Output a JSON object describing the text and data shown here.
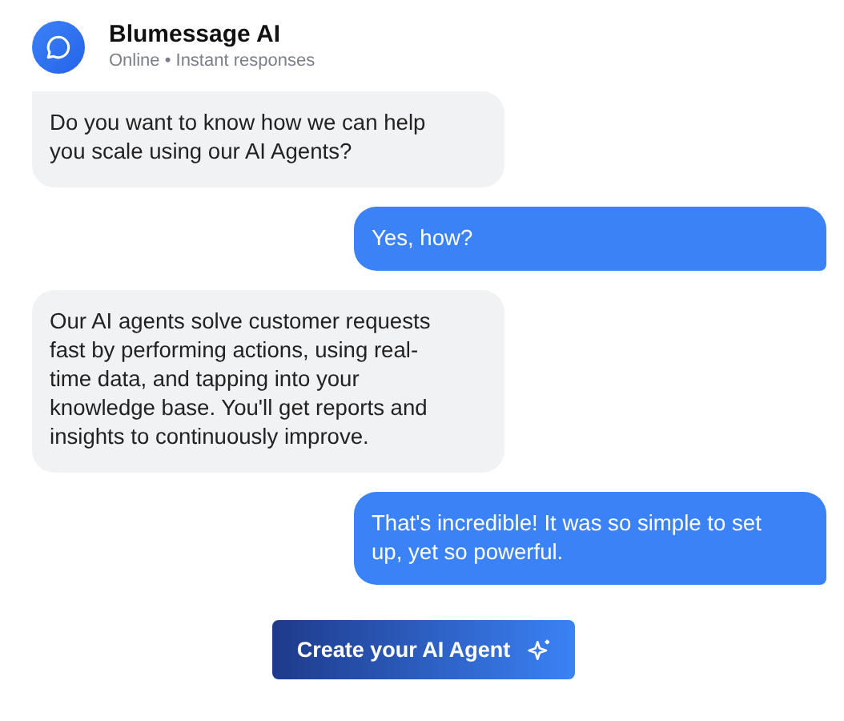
{
  "header": {
    "title": "Blumessage AI",
    "status": "Online • Instant responses"
  },
  "messages": [
    {
      "kind": "bot",
      "text": "Do you want to know how we can help you scale using our AI Agents?"
    },
    {
      "kind": "user",
      "text": "Yes, how?"
    },
    {
      "kind": "bot",
      "text": "Our AI agents solve customer requests fast by performing actions, using real-time data, and tapping into your knowledge base. You'll get reports and insights to continuously improve."
    },
    {
      "kind": "user",
      "text": "That's incredible! It was so simple to set up, yet so powerful."
    }
  ],
  "cta_button": {
    "label": "Create your AI Agent"
  }
}
